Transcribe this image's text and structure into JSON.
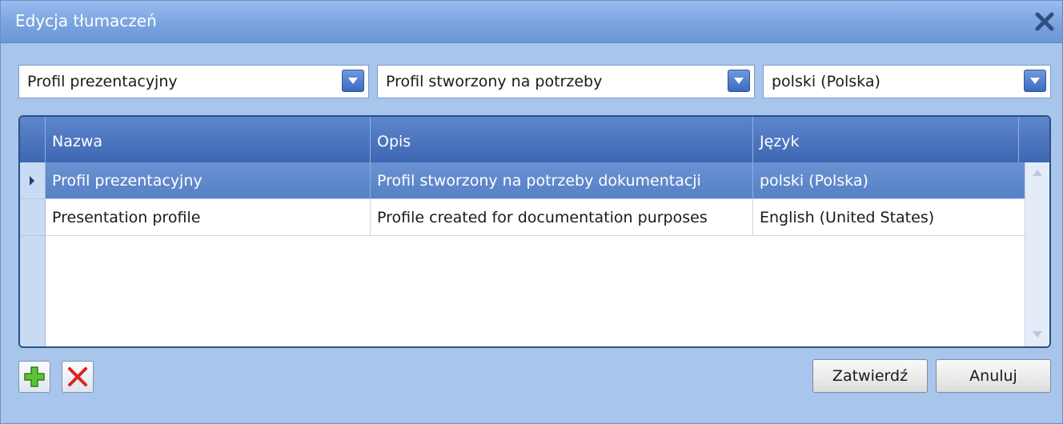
{
  "window": {
    "title": "Edycja tłumaczeń"
  },
  "filters": {
    "name_value": "Profil prezentacyjny",
    "description_value": "Profil stworzony na potrzeby",
    "language_value": "polski (Polska)"
  },
  "grid": {
    "columns": [
      "Nazwa",
      "Opis",
      "Język"
    ],
    "rows": [
      {
        "name": "Profil prezentacyjny",
        "description": "Profil stworzony na potrzeby dokumentacji",
        "language": "polski (Polska)",
        "selected": true
      },
      {
        "name": "Presentation profile",
        "description": "Profile created for documentation purposes",
        "language": "English (United States)",
        "selected": false
      }
    ]
  },
  "buttons": {
    "confirm": "Zatwierdź",
    "cancel": "Anuluj"
  },
  "icons": {
    "close": "close-icon",
    "add": "add-icon",
    "delete": "delete-icon",
    "dropdown": "chevron-down-icon",
    "row_pointer": "row-pointer-icon"
  },
  "colors": {
    "title_bar": "#7aa4df",
    "header": "#3e67b3",
    "selected_row": "#5f88cb",
    "body": "#a8c6ec"
  }
}
